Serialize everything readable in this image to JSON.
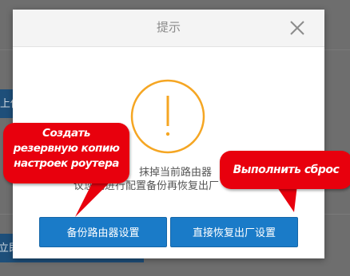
{
  "background": {
    "left_button_label": "上传",
    "bottom_button_label": "立即"
  },
  "dialog": {
    "title": "提示",
    "close_icon": "close-icon",
    "warning_icon": "exclamation-circle-icon",
    "message_line1": "抹掉当前路由器",
    "message_line2": "议您先进行配置备份再恢复出厂",
    "buttons": {
      "backup": "备份路由器设置",
      "reset": "直接恢复出厂设置"
    }
  },
  "callouts": {
    "left_lines": [
      "Создать",
      "резервную копию",
      "настроек роутера"
    ],
    "right": "Выполнить сброс"
  },
  "colors": {
    "accent_orange": "#f5a623",
    "button_blue": "#1a7bc8",
    "callout_red": "#e8000d"
  }
}
